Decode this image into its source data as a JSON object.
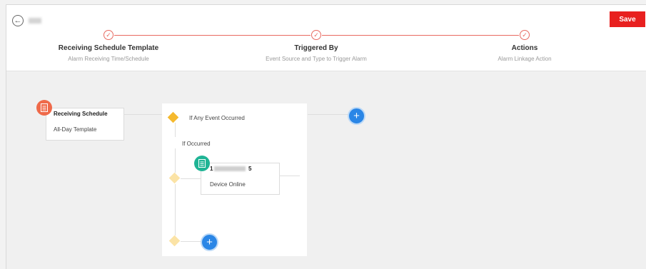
{
  "header": {
    "save_label": "Save",
    "icons": {
      "back": "back-arrow-icon",
      "check": "check-circle-icon"
    }
  },
  "steps": [
    {
      "title": "Receiving Schedule Template",
      "subtitle": "Alarm Receiving Time/Schedule"
    },
    {
      "title": "Triggered By",
      "subtitle": "Event Source and Type to Trigger Alarm"
    },
    {
      "title": "Actions",
      "subtitle": "Alarm Linkage Action"
    }
  ],
  "flow": {
    "schedule_card": {
      "title": "Receiving Schedule",
      "subtitle": "All-Day Template"
    },
    "condition_label": "If Any Event Occurred",
    "occurred_label": "If Occurred",
    "event_card": {
      "title_start": "1",
      "title_end": "5",
      "subtitle": "Device Online"
    },
    "add_symbol": "+"
  },
  "colors": {
    "accent_red": "#e8201f",
    "step_red": "#e86a61",
    "schedule_icon": "#ef6a4a",
    "device_icon": "#1fb495",
    "condition_diamond": "#f5b92e",
    "empty_diamond": "#fbe3a6",
    "add_blue": "#2a86e6"
  }
}
